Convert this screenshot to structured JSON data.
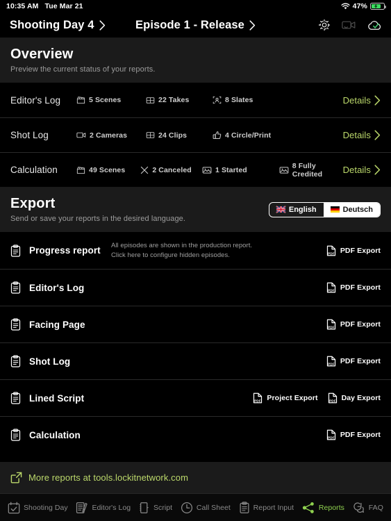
{
  "status_bar": {
    "time": "10:35 AM",
    "date": "Tue Mar 21",
    "battery_percent": "47%",
    "wifi_icon": "wifi-icon",
    "battery_icon": "battery-charging-icon"
  },
  "nav": {
    "left_crumb": "Shooting Day 4",
    "center_crumb": "Episode 1 - Release",
    "icons": [
      {
        "name": "settings-gear-icon"
      },
      {
        "name": "video-sync-icon"
      },
      {
        "name": "cloud-synced-icon"
      }
    ]
  },
  "overview": {
    "title": "Overview",
    "subtitle": "Preview the current status of your reports.",
    "rows": [
      {
        "title": "Editor's Log",
        "details_label": "Details",
        "stats": [
          {
            "icon": "clapperboard-icon",
            "text": "5 Scenes"
          },
          {
            "icon": "filmstrip-icon",
            "text": "22 Takes"
          },
          {
            "icon": "slate-person-icon",
            "text": "8 Slates"
          }
        ]
      },
      {
        "title": "Shot Log",
        "details_label": "Details",
        "stats": [
          {
            "icon": "camera-icon",
            "text": "2 Cameras"
          },
          {
            "icon": "filmstrip-icon",
            "text": "24 Clips"
          },
          {
            "icon": "thumbs-up-icon",
            "text": "4 Circle/Print"
          }
        ]
      },
      {
        "title": "Calculation",
        "details_label": "Details",
        "stats": [
          {
            "icon": "clapperboard-icon",
            "text": "49 Scenes"
          },
          {
            "icon": "x-cancel-icon",
            "text": "2 Canceled"
          },
          {
            "icon": "image-icon",
            "text": "1 Started"
          },
          {
            "icon": "image-icon",
            "text": "8 Fully Credited"
          }
        ]
      }
    ]
  },
  "export": {
    "title": "Export",
    "subtitle": "Send or save your reports in the desired language.",
    "language_toggle": {
      "options": [
        {
          "label": "English",
          "flag": "uk-flag-icon",
          "active": false
        },
        {
          "label": "Deutsch",
          "flag": "german-flag-icon",
          "active": true
        }
      ]
    },
    "rows": [
      {
        "name": "Progress report",
        "note": "All episodes are shown in the production report.\nClick here to configure hidden episodes.",
        "note_line1": "All episodes are shown in the production report.",
        "note_line2": "Click here to configure hidden episodes.",
        "actions": [
          {
            "label": "PDF Export",
            "icon": "pdf-icon"
          }
        ]
      },
      {
        "name": "Editor's Log",
        "note_line1": "",
        "note_line2": "",
        "actions": [
          {
            "label": "PDF Export",
            "icon": "pdf-icon"
          }
        ]
      },
      {
        "name": "Facing Page",
        "note_line1": "",
        "note_line2": "",
        "actions": [
          {
            "label": "PDF Export",
            "icon": "pdf-icon"
          }
        ]
      },
      {
        "name": "Shot Log",
        "note_line1": "",
        "note_line2": "",
        "actions": [
          {
            "label": "PDF Export",
            "icon": "pdf-icon"
          }
        ]
      },
      {
        "name": "Lined Script",
        "note_line1": "",
        "note_line2": "",
        "actions": [
          {
            "label": "Project Export",
            "icon": "pdf-icon"
          },
          {
            "label": "Day Export",
            "icon": "pdf-icon"
          }
        ]
      },
      {
        "name": "Calculation",
        "note_line1": "",
        "note_line2": "",
        "actions": [
          {
            "label": "PDF Export",
            "icon": "pdf-icon"
          }
        ]
      }
    ]
  },
  "footer_link": {
    "label": "More reports at tools.lockitnetwork.com",
    "icon": "external-link-icon"
  },
  "tabbar": {
    "items": [
      {
        "label": "Shooting Day",
        "icon": "calendar-check-icon",
        "active": false
      },
      {
        "label": "Editor's Log",
        "icon": "document-pen-icon",
        "active": false
      },
      {
        "label": "Script",
        "icon": "script-page-icon",
        "active": false
      },
      {
        "label": "Call Sheet",
        "icon": "clock-icon",
        "active": false
      },
      {
        "label": "Report Input",
        "icon": "clipboard-lines-icon",
        "active": false
      },
      {
        "label": "Reports",
        "icon": "share-nodes-icon",
        "active": true
      },
      {
        "label": "FAQ",
        "icon": "speech-bubbles-icon",
        "active": false
      }
    ]
  },
  "colors": {
    "accent_green": "#bcd96b",
    "tab_active_green": "#8fd14f",
    "band_bg": "#1b1b1b",
    "page_bg": "#000000",
    "divider": "#2a2a2a"
  }
}
